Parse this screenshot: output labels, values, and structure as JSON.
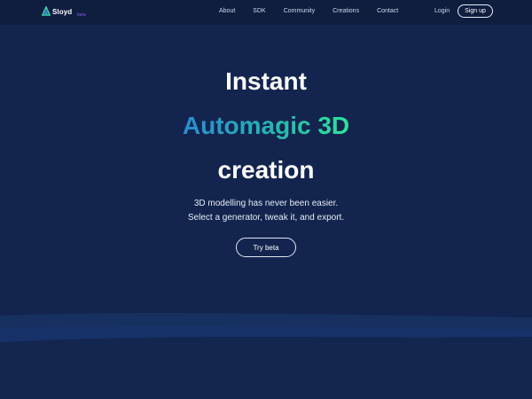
{
  "nav": {
    "brand": "Sloyd",
    "brand_sub": "beta",
    "links": [
      "About",
      "SDK",
      "Community",
      "Creations",
      "Contact"
    ],
    "login": "Login",
    "signup": "Sign up"
  },
  "hero": {
    "line1": "Instant",
    "line2": "Automagic 3D",
    "line3": "creation",
    "subtitle1": "3D modelling has never been easier.",
    "subtitle2": "Select a generator, tweak it, and export.",
    "cta": "Try beta"
  },
  "colors": {
    "background": "#13254f",
    "nav_background": "#0f1d3f",
    "gradient_start": "#2d8bd0",
    "gradient_end": "#2fe39a"
  }
}
